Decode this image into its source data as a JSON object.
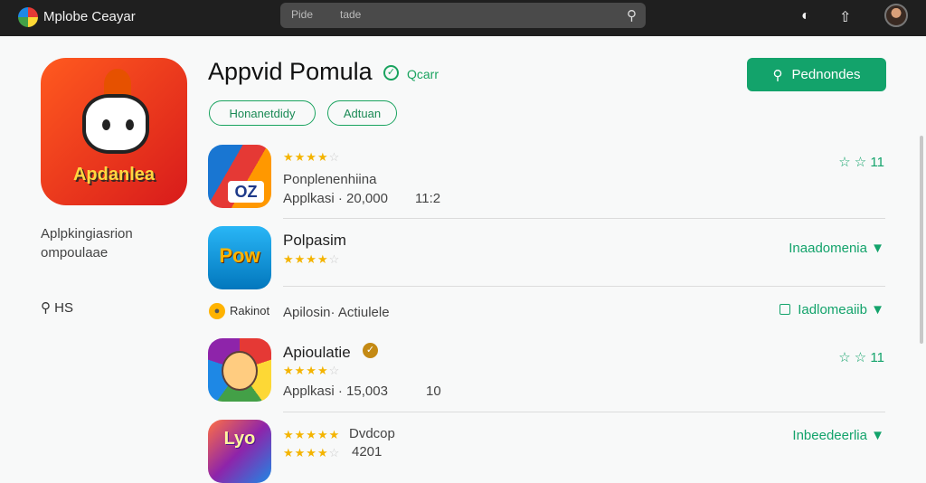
{
  "topbar": {
    "app_name": "Mplobe Ceayar",
    "search_text1": "Pide",
    "search_text2": "tade",
    "search_icon": "search-icon",
    "icon_1": "info-icon",
    "icon_2": "share-icon",
    "avatar": "avatar"
  },
  "sidebar": {
    "icon_title": "Apdanlea",
    "description": "Aplpkingiasrion ompoulaae",
    "search_label": "HS"
  },
  "header": {
    "title": "Appvid Pomula",
    "tag": "Qcarr",
    "cta_label": "Pednondes"
  },
  "chips": [
    "Honanetdidy",
    "Adtuan"
  ],
  "apps": [
    {
      "name": "Ponplenenhiina",
      "stars_filled": 4,
      "sub_left": "Applkasi · 20,000",
      "sub_right": "11:2",
      "right_action": "☆ ☆ 11",
      "icon_text": "OZ"
    },
    {
      "name": "Polpasim",
      "stars_filled": 4,
      "right_action": "Inaadomenia ▼",
      "icon_text": "Pow"
    }
  ],
  "section": {
    "badge_label": "Rakinot",
    "title": "Apilosin· Actiulele",
    "right_action": "Iadlomeaiib ▼"
  },
  "apps2": [
    {
      "name": "Apioulatie",
      "stars_filled": 4,
      "sub_left": "Applkasi · 15,003",
      "sub_right": "10",
      "right_action": "☆ ☆ 11"
    },
    {
      "name": "Dvdcop",
      "stars_filled": 5,
      "stars2_filled": 4,
      "sub_right": "4201",
      "right_action": "Inbeedeerlia ▼",
      "icon_text": "Lyo"
    }
  ],
  "colors": {
    "accent": "#13a36b",
    "star": "#f4b400"
  }
}
